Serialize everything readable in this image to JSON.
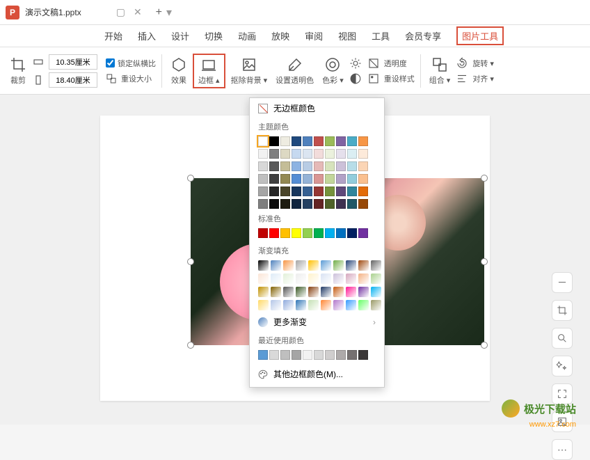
{
  "titlebar": {
    "app_badge": "P",
    "filename": "演示文稿1.pptx"
  },
  "menu": {
    "start": "开始",
    "insert": "插入",
    "design": "设计",
    "transition": "切换",
    "animation": "动画",
    "slideshow": "放映",
    "review": "审阅",
    "view": "视图",
    "tools": "工具",
    "member": "会员专享",
    "picture_tools": "图片工具"
  },
  "toolbar": {
    "crop": "裁剪",
    "width_value": "10.35厘米",
    "height_value": "18.40厘米",
    "lock_ratio": "锁定纵横比",
    "reset_size": "重设大小",
    "effects": "效果",
    "border": "边框",
    "remove_bg": "抠除背景",
    "set_transparent": "设置透明色",
    "color": "色彩",
    "transparency": "透明度",
    "reset_style": "重设样式",
    "group": "组合",
    "rotate": "旋转",
    "align": "对齐"
  },
  "dropdown": {
    "no_border": "无边框颜色",
    "theme_colors": "主题颜色",
    "standard_colors": "标准色",
    "gradient_fill": "渐变填充",
    "more_gradient": "更多渐变",
    "recent_colors": "最近使用颜色",
    "other_colors": "其他边框颜色(M)...",
    "theme_palette_row1": [
      "#ffffff",
      "#000000",
      "#eeece1",
      "#1f497d",
      "#4f81bd",
      "#c0504d",
      "#9bbb59",
      "#8064a2",
      "#4bacc6",
      "#f79646"
    ],
    "theme_palette_shades": [
      [
        "#f2f2f2",
        "#7f7f7f",
        "#ddd9c3",
        "#c6d9f0",
        "#dbe5f1",
        "#f2dcdb",
        "#ebf1dd",
        "#e5e0ec",
        "#dbeef3",
        "#fdeada"
      ],
      [
        "#d8d8d8",
        "#595959",
        "#c4bd97",
        "#8db3e2",
        "#b8cce4",
        "#e5b9b7",
        "#d7e3bc",
        "#ccc1d9",
        "#b7dde8",
        "#fbd5b5"
      ],
      [
        "#bfbfbf",
        "#3f3f3f",
        "#938953",
        "#548dd4",
        "#95b3d7",
        "#d99694",
        "#c3d69b",
        "#b2a2c7",
        "#92cddc",
        "#fac08f"
      ],
      [
        "#a5a5a5",
        "#262626",
        "#494429",
        "#17365d",
        "#366092",
        "#953734",
        "#76923c",
        "#5f497a",
        "#31859b",
        "#e36c09"
      ],
      [
        "#7f7f7f",
        "#0c0c0c",
        "#1d1b10",
        "#0f243e",
        "#244061",
        "#632423",
        "#4f6128",
        "#3f3151",
        "#205867",
        "#974806"
      ]
    ],
    "standard_palette": [
      "#c00000",
      "#ff0000",
      "#ffc000",
      "#ffff00",
      "#92d050",
      "#00b050",
      "#00b0f0",
      "#0070c0",
      "#002060",
      "#7030a0"
    ],
    "gradient_palette": [
      [
        "#000000",
        "#4f81bd",
        "#f79646",
        "#a5a5a5",
        "#ffc000",
        "#5b9bd5",
        "#70ad47",
        "#264478",
        "#9e480e",
        "#636363"
      ],
      [
        "#fbe5d6",
        "#deebf7",
        "#e2f0d9",
        "#ededed",
        "#fff2cc",
        "#d9e2f3",
        "#ccc0da",
        "#d5a6bd",
        "#f4b183",
        "#a9d18e"
      ],
      [
        "#bf9000",
        "#806000",
        "#525252",
        "#385723",
        "#843c0c",
        "#1f3864",
        "#c55a11",
        "#ff1493",
        "#7030a0",
        "#00b0f0"
      ],
      [
        "#ffd966",
        "#b4c7e7",
        "#8faadc",
        "#2e75b6",
        "#c5e0b4",
        "#ff8533",
        "#b277cc",
        "#3399ff",
        "#66ff66",
        "#999966"
      ]
    ],
    "recent_palette": [
      "#5b9bd5",
      "#d9d9d9",
      "#bfbfbf",
      "#a5a5a5",
      "#f2f2f2",
      "#d8d8d8",
      "#d0cece",
      "#aeaaaa",
      "#767171",
      "#3b3838"
    ]
  },
  "watermark": {
    "brand": "极光下载站",
    "url": "www.xz7.com"
  }
}
